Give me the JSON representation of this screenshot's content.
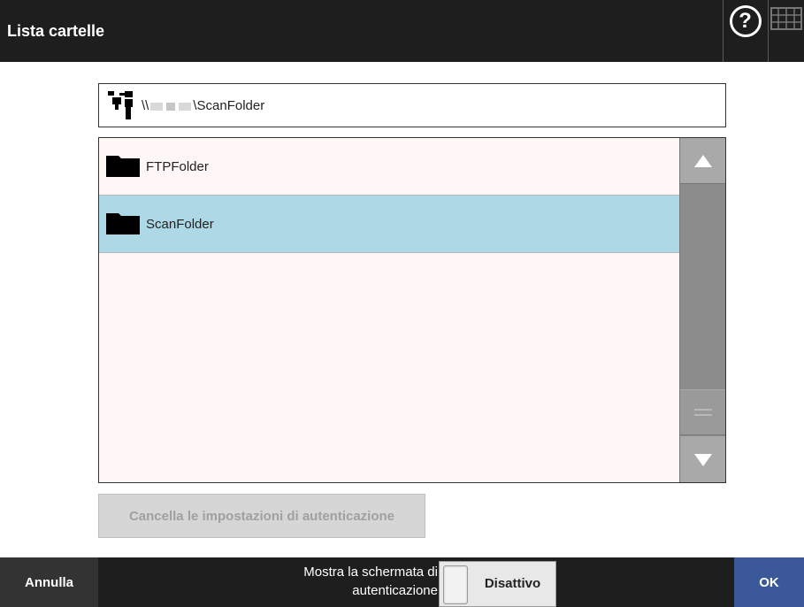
{
  "header": {
    "title": "Lista cartelle",
    "help_icon": "question-circle-icon",
    "keyboard_icon": "keyboard-icon"
  },
  "path": {
    "prefix": "\\\\",
    "suffix": "\\ScanFolder",
    "icon": "network-icon"
  },
  "folders": [
    {
      "label": "FTPFolder",
      "icon": "folder-icon",
      "selected": false
    },
    {
      "label": "ScanFolder",
      "icon": "folder-icon",
      "selected": true
    }
  ],
  "scrollbar": {
    "up_icon": "arrow-up-icon",
    "down_icon": "arrow-down-icon"
  },
  "clear_auth_button": {
    "label": "Cancella le impostazioni di autenticazione",
    "enabled": false
  },
  "footer": {
    "cancel_label": "Annulla",
    "auth_label_line1": "Mostra la schermata di",
    "auth_label_line2": "autenticazione",
    "auth_toggle_value": "Disattivo",
    "ok_label": "OK"
  },
  "colors": {
    "header_bg": "#1e1e1e",
    "selected_row": "#add8e6",
    "list_bg": "#fff7f6",
    "ok_button": "#3b5998"
  }
}
